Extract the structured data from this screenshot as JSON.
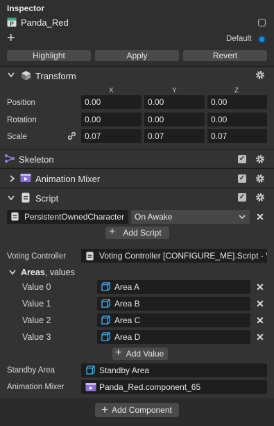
{
  "inspector": {
    "title": "Inspector",
    "object_name": "Panda_Red",
    "add_symbol": "+",
    "layer_label": "Default",
    "buttons": {
      "highlight": "Highlight",
      "apply": "Apply",
      "revert": "Revert"
    }
  },
  "transform": {
    "title": "Transform",
    "axes": [
      "X",
      "Y",
      "Z"
    ],
    "rows": [
      {
        "label": "Position",
        "values": [
          "0.00",
          "0.00",
          "0.00"
        ]
      },
      {
        "label": "Rotation",
        "values": [
          "0.00",
          "0.00",
          "0.00"
        ]
      },
      {
        "label": "Scale",
        "values": [
          "0.07",
          "0.07",
          "0.07"
        ]
      }
    ]
  },
  "skeleton": {
    "title": "Skeleton"
  },
  "animation_mixer_section": {
    "title": "Animation Mixer"
  },
  "script": {
    "title": "Script",
    "script_name": "PersistentOwnedCharacter",
    "event": "On Awake",
    "add_script": "Add Script",
    "voting_controller_label": "Voting Controller",
    "voting_controller_value": "Voting Controller [CONFIGURE_ME].Script - V",
    "areas_label": "Areas",
    "areas_suffix": ", values",
    "areas": [
      {
        "label": "Value 0",
        "value": "Area A"
      },
      {
        "label": "Value 1",
        "value": "Area B"
      },
      {
        "label": "Value 2",
        "value": "Area C"
      },
      {
        "label": "Value 3",
        "value": "Area D"
      }
    ],
    "add_value": "Add Value",
    "standby_label": "Standby Area",
    "standby_value": "Standby Area",
    "anim_mixer_label": "Animation Mixer",
    "anim_mixer_value": "Panda_Red.component_65"
  },
  "add_component": "Add Component",
  "colors": {
    "accent": "#1a8fe3",
    "field_bg": "#1e1e1e",
    "panel_bg": "#333333",
    "button_bg": "#4a4a4a"
  }
}
